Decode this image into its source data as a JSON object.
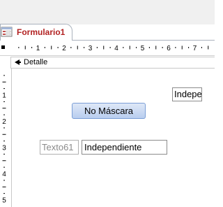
{
  "document_tab": {
    "label": "Formulario1",
    "icon": "form-icon"
  },
  "section": {
    "label": "Detalle",
    "icon": "section-collapse-icon"
  },
  "ruler": {
    "horizontal_labels": [
      "1",
      "2",
      "3",
      "4",
      "5",
      "6",
      "7"
    ],
    "vertical_labels": [
      "1",
      "2",
      "3",
      "4",
      "5"
    ]
  },
  "controls": {
    "button_label": "No Máscara",
    "textbox_top_value": "Independiente",
    "label_texto61": "Texto61",
    "textbox_value": "Independiente"
  },
  "colors": {
    "tab_text": "#b22222",
    "button_fill": "#c8d8f2",
    "button_border": "#7a9ed6"
  }
}
